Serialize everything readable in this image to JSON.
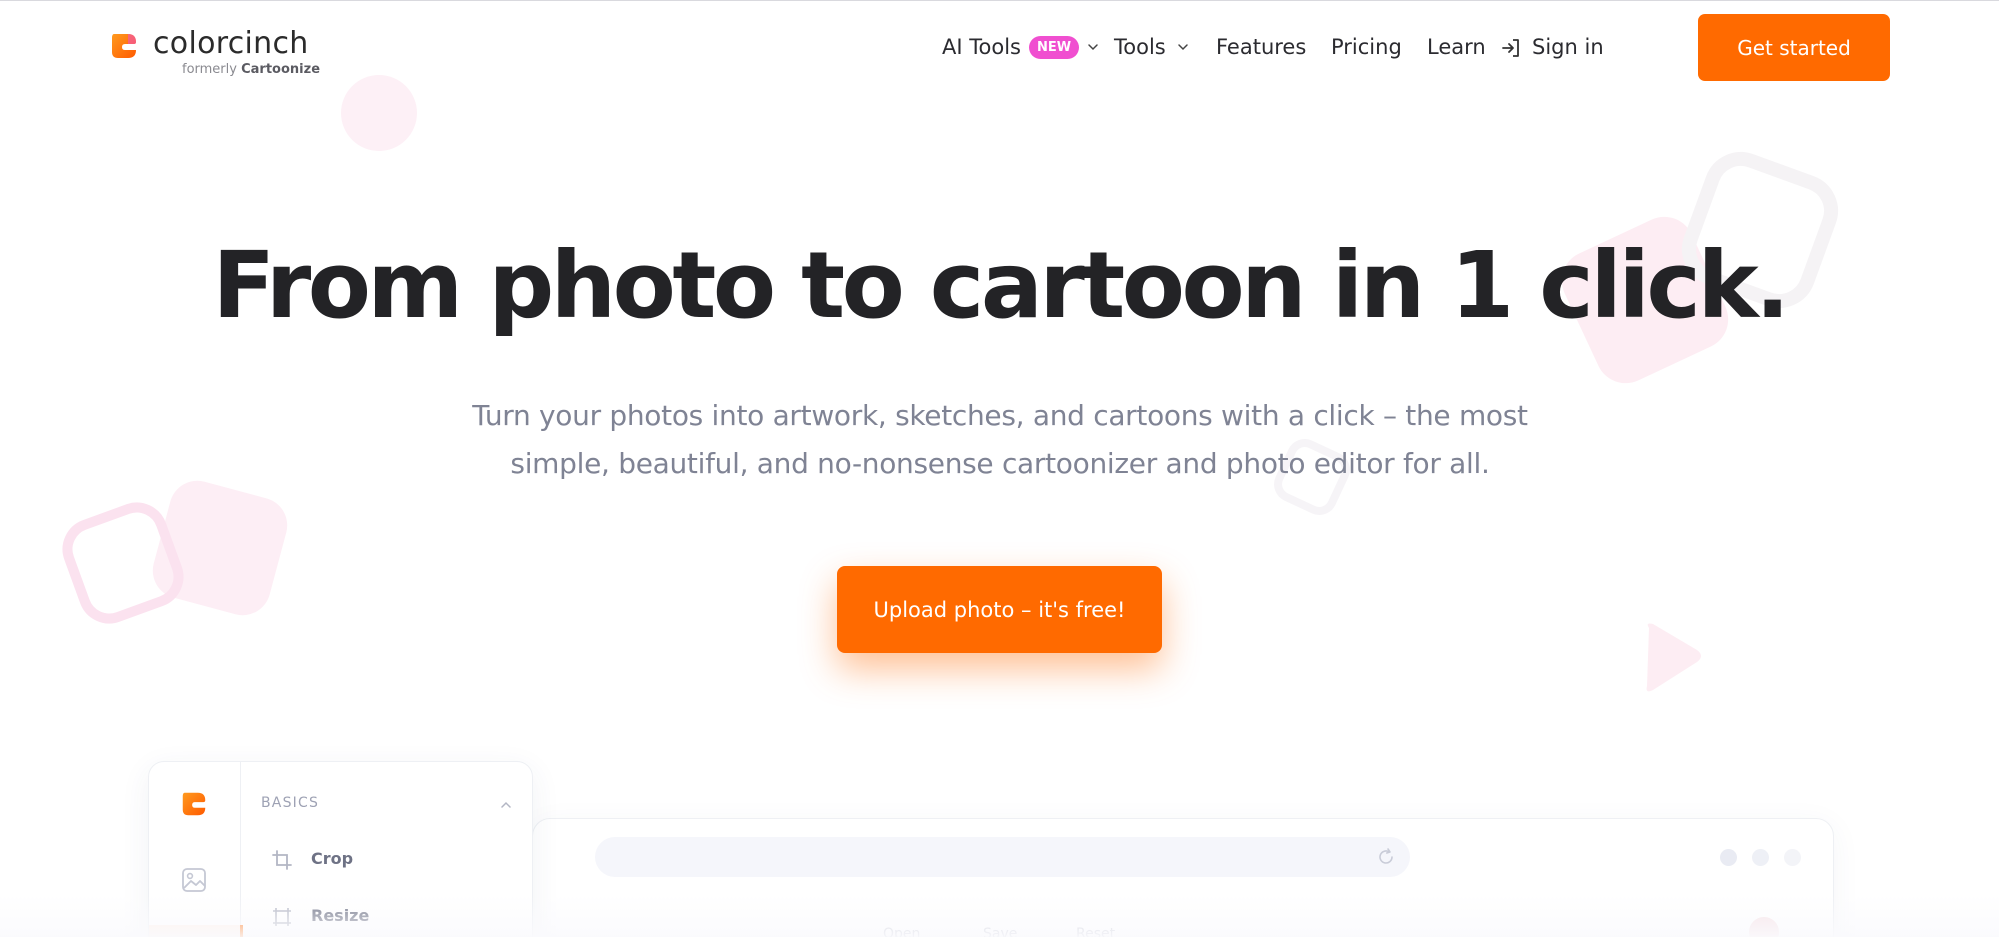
{
  "brand": {
    "name": "colorcinch",
    "formerly_prefix": "formerly",
    "formerly_name": "Cartoonize",
    "logo_icon": "colorcinch-logo-icon",
    "accent_color": "#ff6a00",
    "badge_color": "#f04fd0"
  },
  "nav": {
    "ai_tools": "AI Tools",
    "new_badge": "NEW",
    "tools": "Tools",
    "features": "Features",
    "pricing": "Pricing",
    "learn": "Learn",
    "sign_in": "Sign in",
    "get_started": "Get started"
  },
  "hero": {
    "title": "From photo to cartoon in 1 click.",
    "subtitle_line1": "Turn your photos into artwork, sketches, and cartoons with a click – the most",
    "subtitle_line2": "simple, beautiful, and no-nonsense cartoonizer and photo editor for all.",
    "cta": "Upload photo – it's free!"
  },
  "preview": {
    "section_label": "BASICS",
    "tools": [
      {
        "label": "Crop",
        "icon": "crop-icon"
      },
      {
        "label": "Resize",
        "icon": "resize-icon"
      }
    ],
    "toolbar_labels": [
      "Open",
      "Save",
      "Reset"
    ]
  }
}
